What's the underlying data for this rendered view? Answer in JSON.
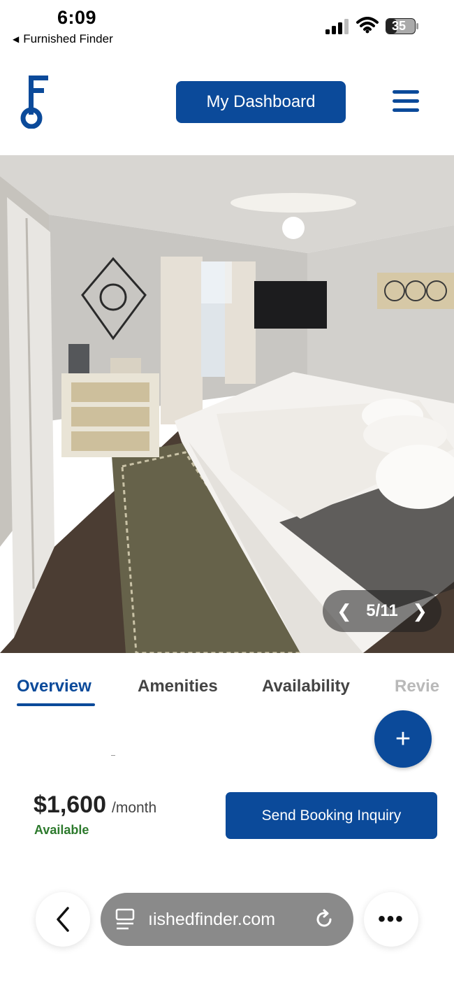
{
  "status_bar": {
    "time": "6:09",
    "back_app": "Furnished Finder",
    "battery": "35"
  },
  "header": {
    "dashboard_label": "My Dashboard"
  },
  "gallery": {
    "counter": "5/11",
    "prev_icon": "chevron-left-icon",
    "next_icon": "chevron-right-icon"
  },
  "tabs": {
    "overview": "Overview",
    "amenities": "Amenities",
    "availability": "Availability",
    "reviews": "Revie"
  },
  "fab": {
    "label": "+"
  },
  "listing": {
    "price": "$1,600",
    "period": "/month",
    "status": "Available",
    "inquiry_label": "Send Booking Inquiry"
  },
  "browser": {
    "url": "ıishedfinder.com"
  },
  "colors": {
    "brand": "#0b4a9a",
    "available": "#2d7a2d"
  }
}
